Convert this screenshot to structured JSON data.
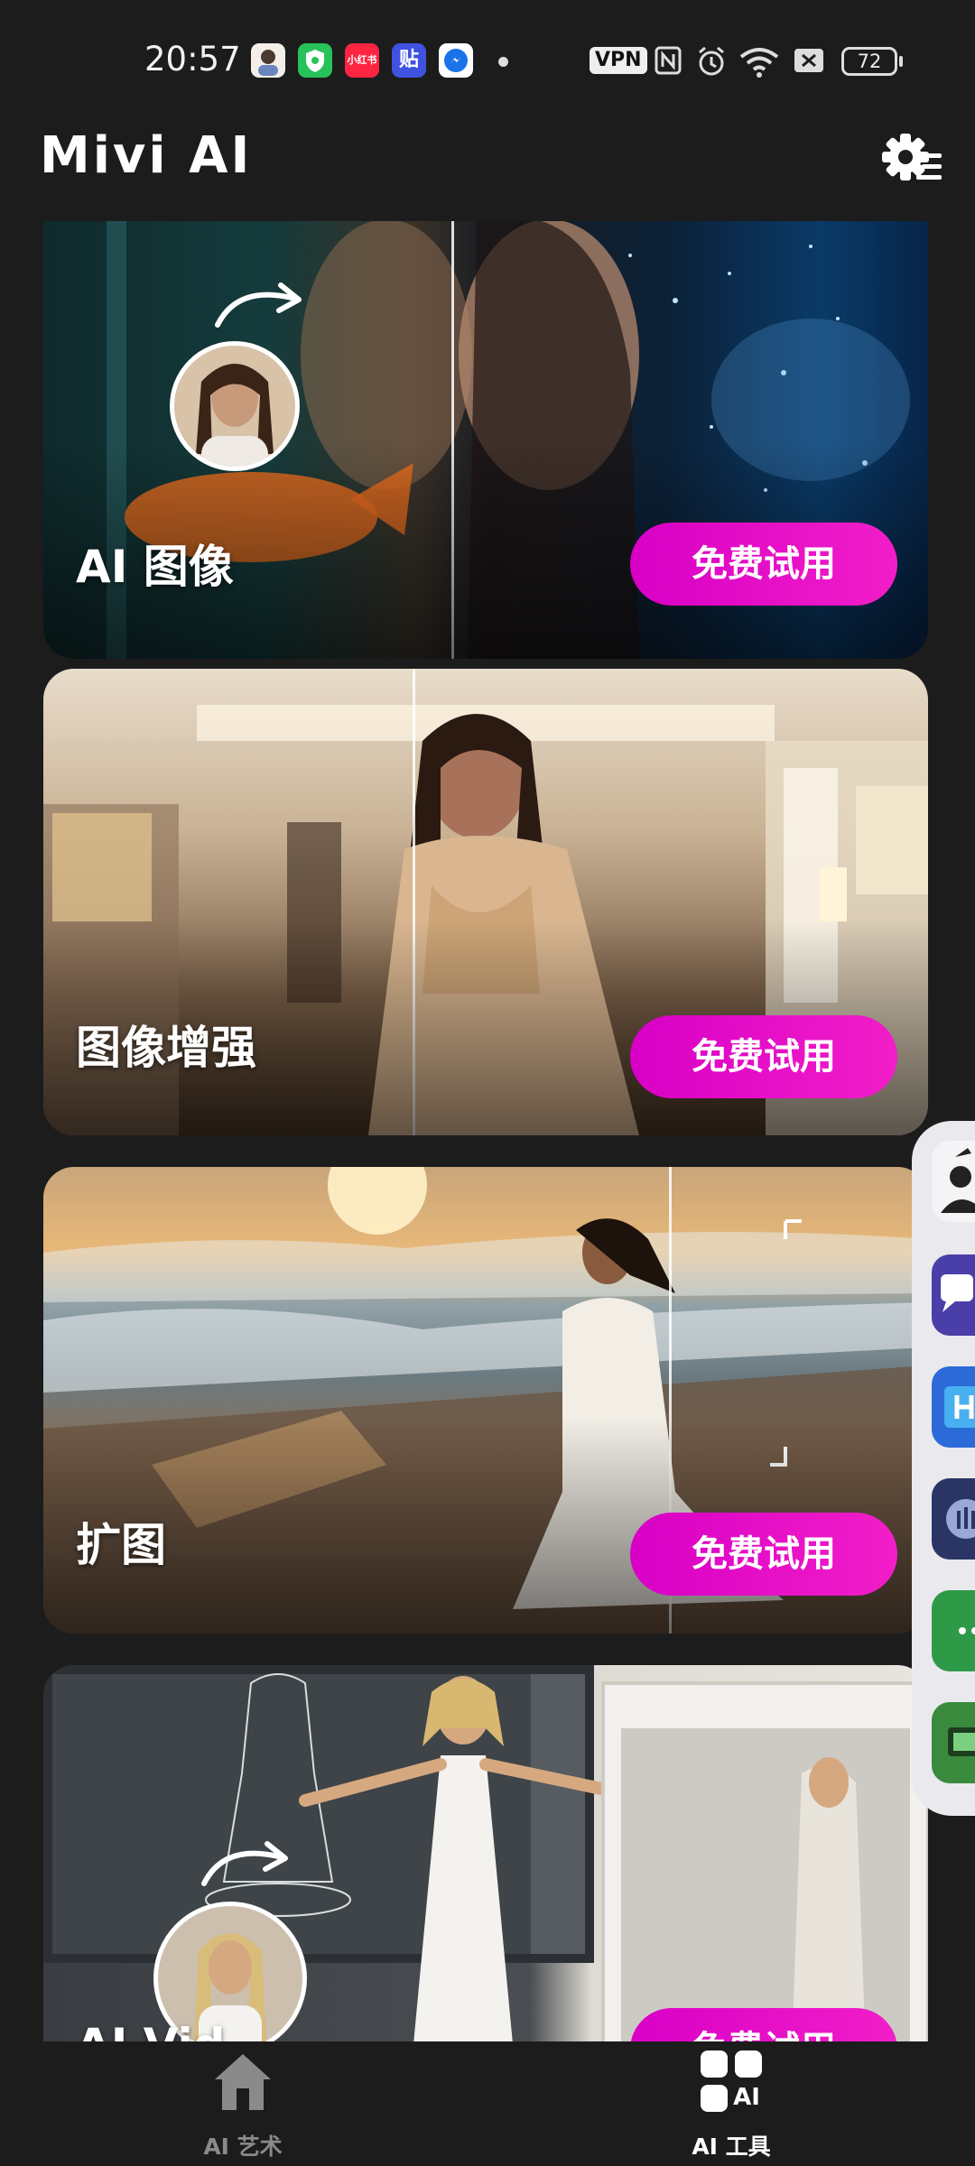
{
  "status_bar": {
    "time": "20:57",
    "notification_icons": [
      "avatar-app-icon",
      "shield-app-icon",
      "xiaohongshu-app-icon",
      "tieba-app-icon",
      "messenger-app-icon"
    ],
    "xiaohongshu_label": "小红书",
    "tieba_label": "贴",
    "vpn_label": "VPN",
    "battery": "72"
  },
  "header": {
    "title": "Mivi AI"
  },
  "cards": [
    {
      "title": "AI 图像",
      "button": "免费试用"
    },
    {
      "title": "图像增强",
      "button": "免费试用"
    },
    {
      "title": "扩图",
      "button": "免费试用"
    },
    {
      "title": "AI Vid",
      "button": "免费试用"
    }
  ],
  "bottom_nav": {
    "items": [
      {
        "label": "AI 艺术",
        "icon": "home-icon",
        "active": false
      },
      {
        "label": "AI 工具",
        "icon": "ai-tools-icon",
        "active": true
      }
    ],
    "ai_badge": "AI"
  },
  "colors": {
    "background": "#1c1c1c",
    "accent": "#e20fc8",
    "inactive": "#8a8a8a"
  }
}
